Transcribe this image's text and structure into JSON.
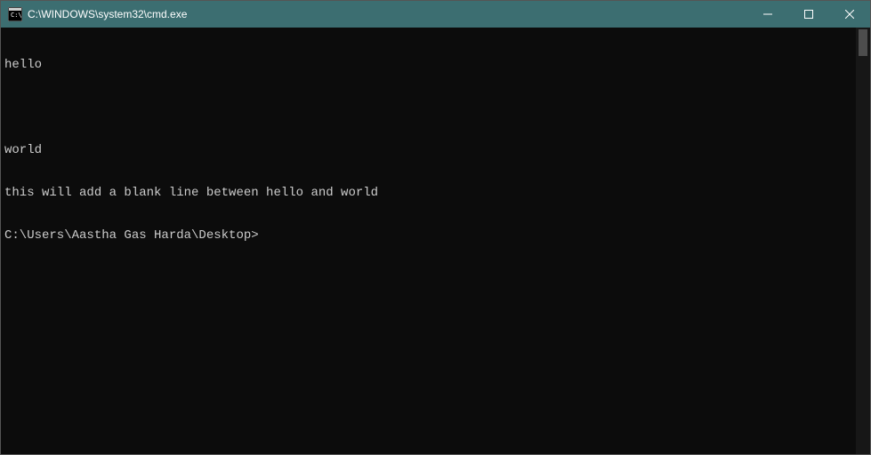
{
  "titlebar": {
    "title": "C:\\WINDOWS\\system32\\cmd.exe"
  },
  "terminal": {
    "lines": [
      "hello",
      "",
      "world",
      "this will add a blank line between hello and world"
    ],
    "prompt": "C:\\Users\\Aastha Gas Harda\\Desktop>"
  }
}
